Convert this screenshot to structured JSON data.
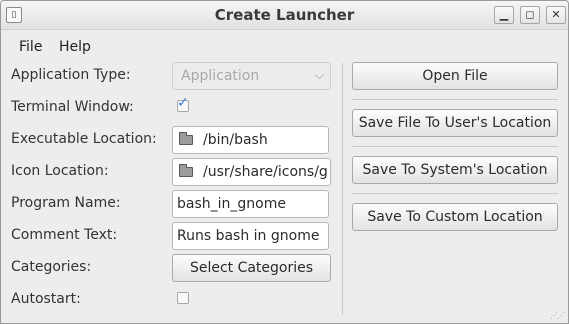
{
  "window": {
    "title": "Create Launcher"
  },
  "menu": {
    "file": "File",
    "help": "Help"
  },
  "form": {
    "application_type": {
      "label": "Application Type:",
      "value": "Application"
    },
    "terminal_window": {
      "label": "Terminal Window:",
      "checked": true
    },
    "executable_location": {
      "label": "Executable Location:",
      "value": "/bin/bash"
    },
    "icon_location": {
      "label": "Icon Location:",
      "value": "/usr/share/icons/g"
    },
    "program_name": {
      "label": "Program Name:",
      "value": "bash_in_gnome"
    },
    "comment_text": {
      "label": "Comment Text:",
      "value": "Runs bash in gnome"
    },
    "categories": {
      "label": "Categories:",
      "button": "Select Categories"
    },
    "autostart": {
      "label": "Autostart:",
      "checked": false
    }
  },
  "actions": {
    "open_file": "Open File",
    "save_user": "Save File To User's Location",
    "save_system": "Save To System's Location",
    "save_custom": "Save To Custom Location"
  },
  "icons": {
    "app": "launcher-app-icon",
    "minimize": "minimize-icon",
    "maximize": "maximize-icon",
    "close": "close-icon",
    "folder": "folder-icon",
    "dropdown": "chevron-down-icon",
    "check": "checkmark-icon",
    "resize": "resize-grip-icon"
  },
  "colors": {
    "check_accent": "#3b7bd8",
    "disabled_text": "#a8a8a8"
  }
}
